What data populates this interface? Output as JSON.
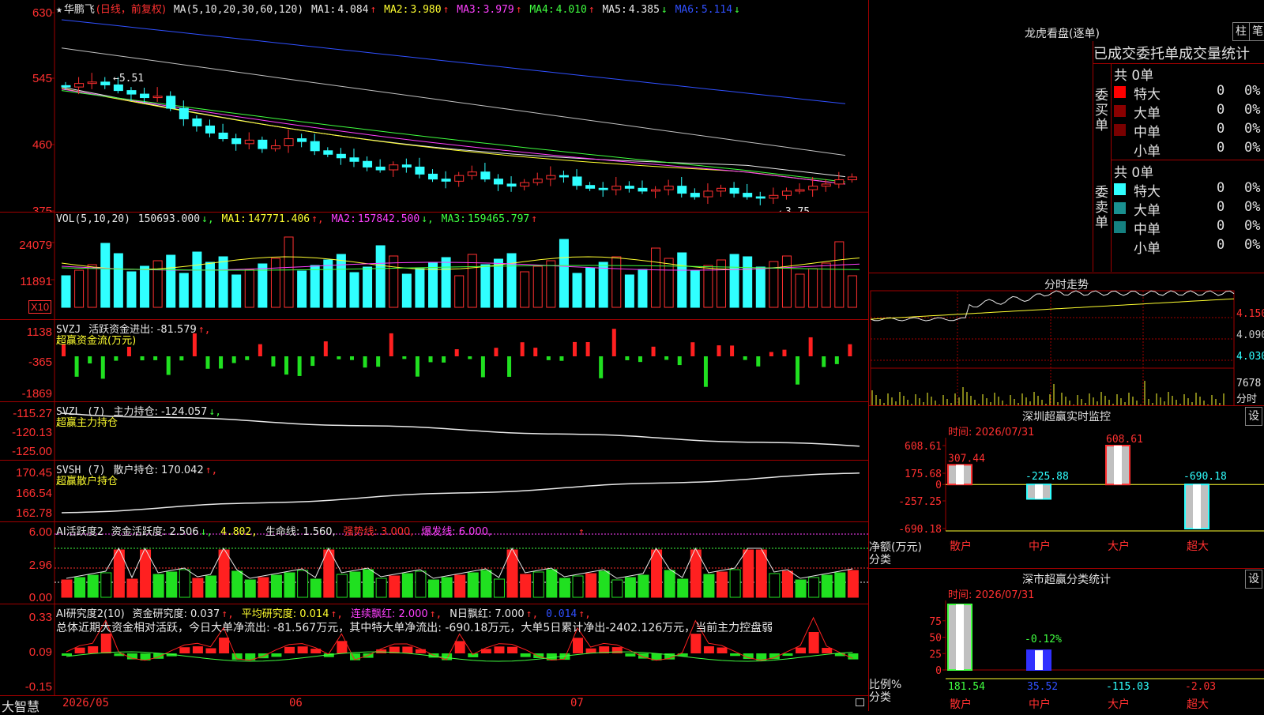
{
  "stock": {
    "star": "★",
    "name": "华鹏飞",
    "period": "(日线，前复权)",
    "ma_label": "MA(5,10,20,30,60,120)",
    "ma": [
      {
        "label": "MA1:",
        "value": "4.084",
        "arrow": "↑",
        "color": "#e8e8e8"
      },
      {
        "label": "MA2:",
        "value": "3.980",
        "arrow": "↑",
        "color": "#ffff30"
      },
      {
        "label": "MA3:",
        "value": "3.979",
        "arrow": "↑",
        "color": "#ff40ff"
      },
      {
        "label": "MA4:",
        "value": "4.010",
        "arrow": "↑",
        "color": "#40ff40"
      },
      {
        "label": "MA5:",
        "value": "4.385",
        "arrow": "↓",
        "color": "#e8e8e8"
      },
      {
        "label": "MA6:",
        "value": "5.114",
        "arrow": "↓",
        "color": "#3050ff"
      }
    ],
    "y_ticks": [
      "630",
      "545",
      "460",
      "375"
    ],
    "high_mark": "←5.51",
    "low_mark": "←3.75"
  },
  "vol": {
    "label": "VOL(5,10,20)",
    "value": "150693.000",
    "value_arrow": "↓,",
    "ma": [
      {
        "label": "MA1:",
        "value": "147771.406",
        "arrow": "↑,",
        "color": "#ffff30"
      },
      {
        "label": "MA2:",
        "value": "157842.500",
        "arrow": "↓,",
        "color": "#ff40ff"
      },
      {
        "label": "MA3:",
        "value": "159465.797",
        "arrow": "↑",
        "color": "#40ff40"
      }
    ],
    "y_ticks": [
      "24079",
      "11891"
    ],
    "unit": "X10"
  },
  "svzj": {
    "label": "SVZJ",
    "text": "活跃资金进出: -81.579",
    "arrow": "↑,",
    "subtitle": "超赢资金流(万元)",
    "y_ticks": [
      "1138",
      "-365",
      "-1869"
    ]
  },
  "svzl": {
    "label": "SVZL (7)",
    "text": "主力持仓: -124.057",
    "arrow": "↓,",
    "subtitle": "超赢主力持仓",
    "y_ticks": [
      "-115.27",
      "-120.13",
      "-125.00"
    ]
  },
  "svsh": {
    "label": "SVSH (7)",
    "text": "散户持仓: 170.042",
    "arrow": "↑,",
    "subtitle": "超赢散户持仓",
    "y_ticks": [
      "170.45",
      "166.54",
      "162.78"
    ]
  },
  "ai_act": {
    "label": "AI活跃度2",
    "text1": "资金活跃度: 2.506",
    "arrow1": "↓,",
    "text2": "4.802,",
    "text3": "生命线: 1.560,",
    "text4": "强势线: 3.000,",
    "text5": "爆发线: 6.000,",
    "arrow5": "↑",
    "y_ticks": [
      "6.00",
      "2.96",
      "0.00"
    ]
  },
  "ai_res": {
    "label": "AI研究度2(10)",
    "text1": "资金研究度: 0.037",
    "arrow1": "↑,",
    "text2": "平均研究度: 0.014",
    "arrow2": "↑,",
    "text3": "连续飘红: 2.000",
    "arrow3": "↑,",
    "text4": "N日飘红: 7.000",
    "arrow4": "↑,",
    "text5": "0.014",
    "arrow5": "↑,",
    "summary": "总体近期大资金相对活跃，今日大单净流出: -81.567万元，其中特大单净流出: -690.18万元，大单5日累计净出-2402.126万元，当前主力控盘弱",
    "y_ticks": [
      "0.33",
      "0.09",
      "-0.15"
    ]
  },
  "bottom": {
    "brand": "大智慧",
    "dates": [
      "2026/05",
      "06",
      "07"
    ]
  },
  "right": {
    "title": "龙虎看盘(逐单)",
    "btn_bar": "柱",
    "btn_tick": "笔",
    "stat_title": "已成交委托单成交量统计",
    "buy": {
      "side": "委买单",
      "total": "共 0单",
      "rows": [
        {
          "label": "特大",
          "count": "0",
          "pct": "0%",
          "color": "#ff0000"
        },
        {
          "label": "大单",
          "count": "0",
          "pct": "0%",
          "color": "#8b0000"
        },
        {
          "label": "中单",
          "count": "0",
          "pct": "0%",
          "color": "#7a0000"
        },
        {
          "label": "小单",
          "count": "0",
          "pct": "0%",
          "color": "#000000"
        }
      ]
    },
    "sell": {
      "side": "委卖单",
      "total": "共 0单",
      "rows": [
        {
          "label": "特大",
          "count": "0",
          "pct": "0%",
          "color": "#30ffff"
        },
        {
          "label": "大单",
          "count": "0",
          "pct": "0%",
          "color": "#1a9090"
        },
        {
          "label": "中单",
          "count": "0",
          "pct": "0%",
          "color": "#158080"
        },
        {
          "label": "小单",
          "count": "0",
          "pct": "0%",
          "color": "#000000"
        }
      ]
    },
    "intraday": {
      "title": "分时走势",
      "prices": [
        "4.150",
        "4.090",
        "4.030"
      ],
      "vol": "7678",
      "unit": "分时"
    },
    "monitor": {
      "title": "深圳超赢实时监控",
      "btn": "设",
      "time": "时间: 2026/07/31",
      "y_ticks": [
        "608.61",
        "175.68",
        "0",
        "-257.25",
        "-690.18"
      ],
      "axis_label": "净额(万元)",
      "cat_label": "分类",
      "categories": [
        "散户",
        "中户",
        "大户",
        "超大"
      ],
      "values": [
        307.44,
        -225.88,
        608.61,
        -690.18
      ],
      "value_labels": [
        "307.44",
        "-225.88",
        "608.61",
        "-690.18"
      ]
    },
    "classify": {
      "title": "深市超赢分类统计",
      "btn": "设",
      "time": "时间: 2026/07/31",
      "y_ticks": [
        "75",
        "50",
        "25",
        "0"
      ],
      "axis_label": "比例%",
      "cat_label": "分类",
      "categories": [
        "散户",
        "中户",
        "大户",
        "超大"
      ],
      "bar_pct": [
        100,
        30,
        0,
        0
      ],
      "bar_label": "-0.12%",
      "values": [
        "181.54",
        "35.52",
        "-115.03",
        "-2.03"
      ],
      "value_colors": [
        "#40ff40",
        "#3050ff",
        "#30ffff",
        "#ff3030"
      ]
    }
  },
  "chart_data": [
    {
      "type": "candlestick",
      "title": "华鹏飞(日线，前复权)",
      "ylim": [
        3.6,
        6.4
      ],
      "x_labels": [
        "2026/05",
        "06",
        "07"
      ],
      "close": [
        5.35,
        5.4,
        5.42,
        5.38,
        5.3,
        5.25,
        5.2,
        5.22,
        5.05,
        4.9,
        4.8,
        4.7,
        4.62,
        4.55,
        4.6,
        4.48,
        4.52,
        4.62,
        4.58,
        4.45,
        4.4,
        4.35,
        4.3,
        4.22,
        4.18,
        4.25,
        4.22,
        4.12,
        4.05,
        4.02,
        4.1,
        4.15,
        4.05,
        3.98,
        3.95,
        4.0,
        4.05,
        4.1,
        4.08,
        3.96,
        3.92,
        3.9,
        3.95,
        3.92,
        3.88,
        3.9,
        3.95,
        3.85,
        3.8,
        3.88,
        3.92,
        3.85,
        3.8,
        3.78,
        3.82,
        3.88,
        3.9,
        3.95,
        3.98,
        4.04,
        4.08
      ],
      "series": [
        {
          "name": "MA1",
          "values_end": 4.084
        },
        {
          "name": "MA2",
          "values_end": 3.98
        },
        {
          "name": "MA3",
          "values_end": 3.979
        },
        {
          "name": "MA4",
          "values_end": 4.01
        },
        {
          "name": "MA5",
          "values_end": 4.385
        },
        {
          "name": "MA6",
          "values_end": 5.114
        }
      ]
    }
  ]
}
